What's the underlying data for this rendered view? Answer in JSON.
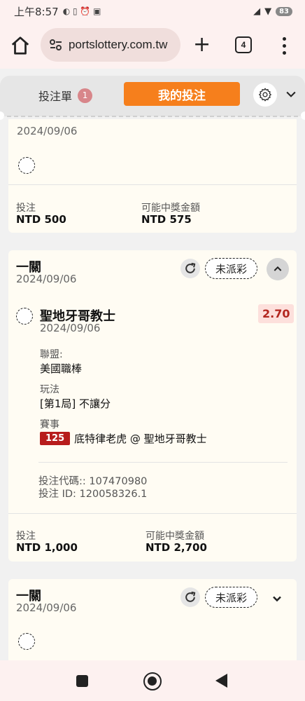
{
  "status_bar": {
    "time": "上午8:57",
    "battery": "83"
  },
  "browser": {
    "url": "portslottery.com.tw",
    "tab_count": "4"
  },
  "slip_header": {
    "slip_tab_label": "投注單",
    "slip_count": "1",
    "my_bets_label": "我的投注"
  },
  "cards": [
    {
      "date": "2024/09/06",
      "stake_label": "投注",
      "stake_value": "NTD 500",
      "payout_label": "可能中獎金額",
      "payout_value": "NTD 575"
    },
    {
      "title": "一關",
      "date": "2024/09/06",
      "status": "未派彩",
      "selection": {
        "team": "聖地牙哥教士",
        "date": "2024/09/06",
        "odds": "2.70",
        "league_label": "聯盟:",
        "league_value": "美國職棒",
        "market_label": "玩法",
        "market_value": "[第1局] 不讓分",
        "event_label": "賽事",
        "game_no": "125",
        "event_value": "底特律老虎 @ 聖地牙哥教士",
        "bet_code": "投注代碼:: 107470980",
        "bet_id": "投注 ID: 120058326.1"
      },
      "stake_label": "投注",
      "stake_value": "NTD 1,000",
      "payout_label": "可能中獎金額",
      "payout_value": "NTD 2,700"
    },
    {
      "title": "一關",
      "date": "2024/09/06",
      "status": "未派彩"
    }
  ],
  "icons": {
    "home": "home-icon",
    "site_settings": "tune-icon",
    "new_tab": "plus-icon",
    "menu": "more-vert-icon",
    "settings": "gear-icon",
    "refresh": "refresh-icon",
    "chevron_up": "chevron-up-icon",
    "chevron_down": "chevron-down-icon"
  },
  "colors": {
    "accent": "#f67f1c",
    "odds_bg": "#fde0dc",
    "odds_text": "#b3261e",
    "game_no_bg": "#b71c1c",
    "card_bg": "#fffcf3"
  }
}
